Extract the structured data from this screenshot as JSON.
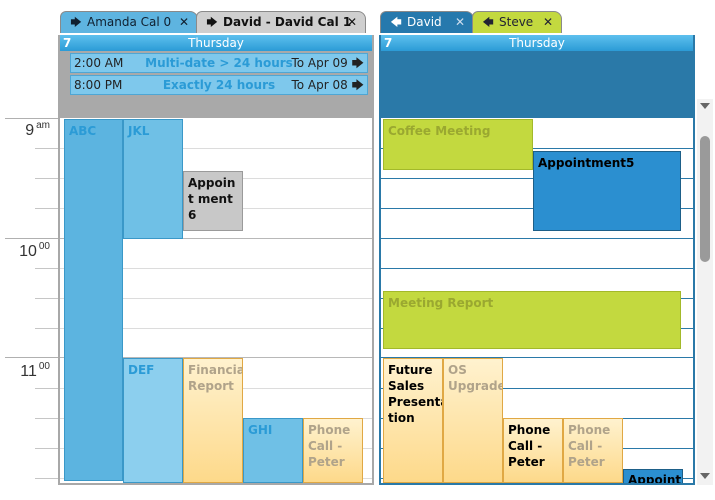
{
  "tabs_left": [
    {
      "label": "Amanda Cal 0",
      "arrow": "🡆",
      "close": "✕"
    },
    {
      "label": "David - David Cal 1",
      "arrow": "🡆",
      "close": "✕"
    }
  ],
  "tabs_right": [
    {
      "label": "David",
      "arrow": "🡄",
      "close": "✕"
    },
    {
      "label": "Steve",
      "arrow": "🡄",
      "close": "✕"
    }
  ],
  "left_cal": {
    "day_number": "7",
    "day_name": "Thursday",
    "multiday": [
      {
        "start": "2:00 AM",
        "desc": "Multi-date > 24 hours",
        "to": "To Apr 09",
        "arrow": "🡆"
      },
      {
        "start": "8:00 PM",
        "desc": "Exactly 24 hours",
        "to": "To Apr 08",
        "arrow": "🡆"
      }
    ],
    "appointments": {
      "abc": "ABC",
      "jkl": "JKL",
      "appt6": "Appoint ment6",
      "def": "DEF",
      "financial": "Financial Report",
      "ghi": "GHI",
      "phone_peter": "Phone Call - Peter"
    }
  },
  "right_cal": {
    "day_number": "7",
    "day_name": "Thursday",
    "appointments": {
      "coffee": "Coffee Meeting",
      "appt5": "Appointment5",
      "meeting_report": "Meeting Report",
      "future_sales": "Future Sales Presenta tion",
      "os_upgrade": "OS Upgrade",
      "phone1": "Phone Call - Peter",
      "phone2": "Phone Call - Peter",
      "appoint_cut": "Appoint"
    }
  },
  "times": [
    {
      "hour": "9",
      "suffix": "am"
    },
    {
      "hour": "10",
      "suffix": "00"
    },
    {
      "hour": "11",
      "suffix": "00"
    }
  ],
  "colors": {
    "blue_dark": "#2a79a8",
    "blue_light": "#5cb4e0",
    "green": "#c3d93f",
    "orange_light": "#fde2a3",
    "grey_tab": "#c8c8c8"
  }
}
